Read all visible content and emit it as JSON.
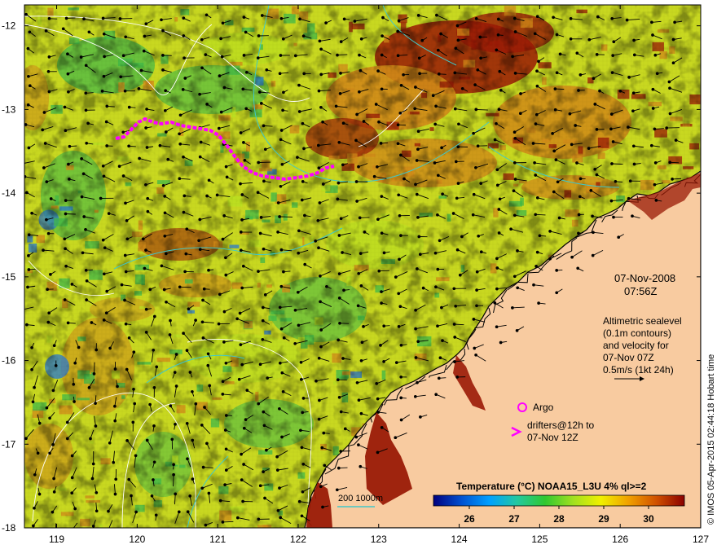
{
  "map": {
    "date_line": "07-Nov-2008",
    "time_line": "07:56Z",
    "altimetry_lines": [
      "Altimetric sealevel",
      "(0.1m contours)",
      "and velocity for",
      "07-Nov 07Z"
    ],
    "velocity_scale": "0.5m/s (1kt 24h)",
    "argo_label": "Argo",
    "drifters_lines": [
      "drifters@12h to",
      "07-Nov 12Z"
    ],
    "depth_legend": "200  1000m",
    "credit": "© IMOS 05-Apr-2015 02:44:18 Hobart time",
    "colorbar": {
      "title": "Temperature (°C) NOAA15_L3U 4% ql>=2",
      "ticks": [
        26,
        27,
        28,
        29,
        30
      ],
      "range": [
        25.2,
        30.8
      ],
      "colors": [
        "#00007f",
        "#0050d0",
        "#00a0ff",
        "#22c8a0",
        "#30c830",
        "#a0e020",
        "#f0f000",
        "#f0a000",
        "#d05000",
        "#8b0000"
      ]
    },
    "axes": {
      "x_ticks": [
        "119",
        "120",
        "121",
        "122",
        "123",
        "124",
        "125",
        "126",
        "127"
      ],
      "y_ticks": [
        "-12",
        "-13",
        "-14",
        "-15",
        "-16",
        "-17",
        "-18"
      ],
      "lon_range": [
        118.6,
        127.0
      ],
      "lat_range": [
        -18.0,
        -11.75
      ]
    },
    "colors": {
      "land": "#f8cba0",
      "coastline": "#000000",
      "isobath": "#40c8c8",
      "contour": "#ffffff",
      "drifter": "#ff00ff",
      "hot": "#9a1a06",
      "warm": "#d08a18",
      "mid": "#b8e020",
      "cool": "#40b848",
      "cold": "#2878d0"
    }
  }
}
